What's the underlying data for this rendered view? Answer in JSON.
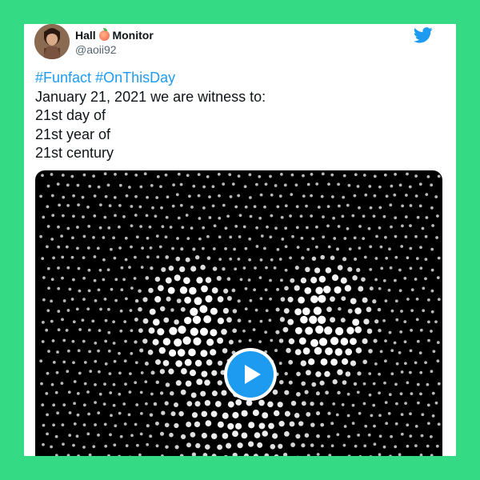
{
  "user": {
    "display_name_part1": "Hall",
    "display_name_part2": "Monitor",
    "handle": "@aoii92"
  },
  "tweet": {
    "hashtag1": "#Funfact",
    "hashtag2": "#OnThisDay",
    "lines": [
      "January 21, 2021 we are witness to:",
      "21st day of",
      "21st year of",
      "21st century"
    ]
  },
  "colors": {
    "background": "#34db84",
    "link": "#1d9bf0",
    "text": "#0f1419",
    "secondary_text": "#536471"
  },
  "icons": {
    "brand": "twitter-bird-icon",
    "media_control": "play-icon",
    "emoji": "peach-emoji-icon"
  }
}
